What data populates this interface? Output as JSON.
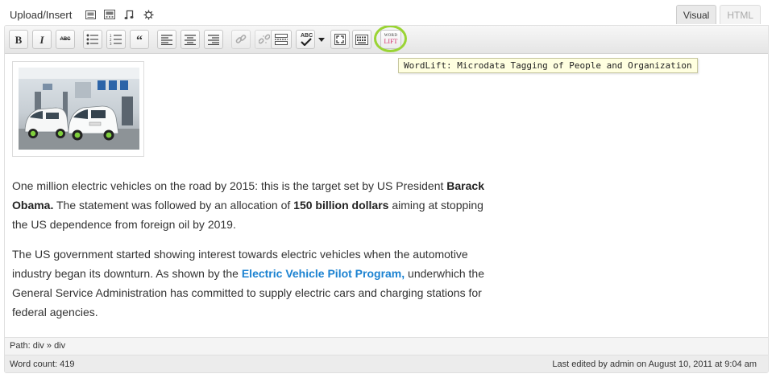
{
  "media_bar": {
    "label": "Upload/Insert",
    "icons": [
      "image-icon",
      "video-icon",
      "audio-icon",
      "media-icon"
    ]
  },
  "tabs": {
    "visual": "Visual",
    "html": "HTML"
  },
  "toolbar": {
    "bold": "B",
    "italic": "I",
    "strikethrough": "ABC",
    "blockquote": "“",
    "spellcheck": "ABC",
    "wordlift_top": "WORD",
    "wordlift_bottom": "LIFT"
  },
  "tooltip": {
    "text": "WordLift: Microdata Tagging of People and Organization"
  },
  "content": {
    "p1_a": "One million electric vehicles on the road by 2015: this is the target set by US President ",
    "p1_b": "Barack Obama.",
    "p1_c": " The statement was followed by an allocation of ",
    "p1_d": "150 billion dollars",
    "p1_e": " aiming at stopping the US dependence from foreign oil by 2019.",
    "p2_a": "The US government started showing interest towards electric vehicles when the automotive industry began its downturn. As shown by the ",
    "p2_link": "Electric Vehicle Pilot Program,",
    "p2_b": " underwhich the General Service Administration has committed to supply electric cars and charging stations for federal agencies."
  },
  "path_bar": {
    "label": "Path:",
    "path_1": "div",
    "separator": "»",
    "path_2": "div"
  },
  "status": {
    "word_count": "Word count: 419",
    "last_edited": "Last edited by admin on August 10, 2011 at 9:04 am"
  },
  "colors": {
    "link": "#1b82d1",
    "highlight_ring": "#9ad434",
    "tooltip_bg": "#ffffe0",
    "wordlift_accent": "#d22f6a"
  }
}
